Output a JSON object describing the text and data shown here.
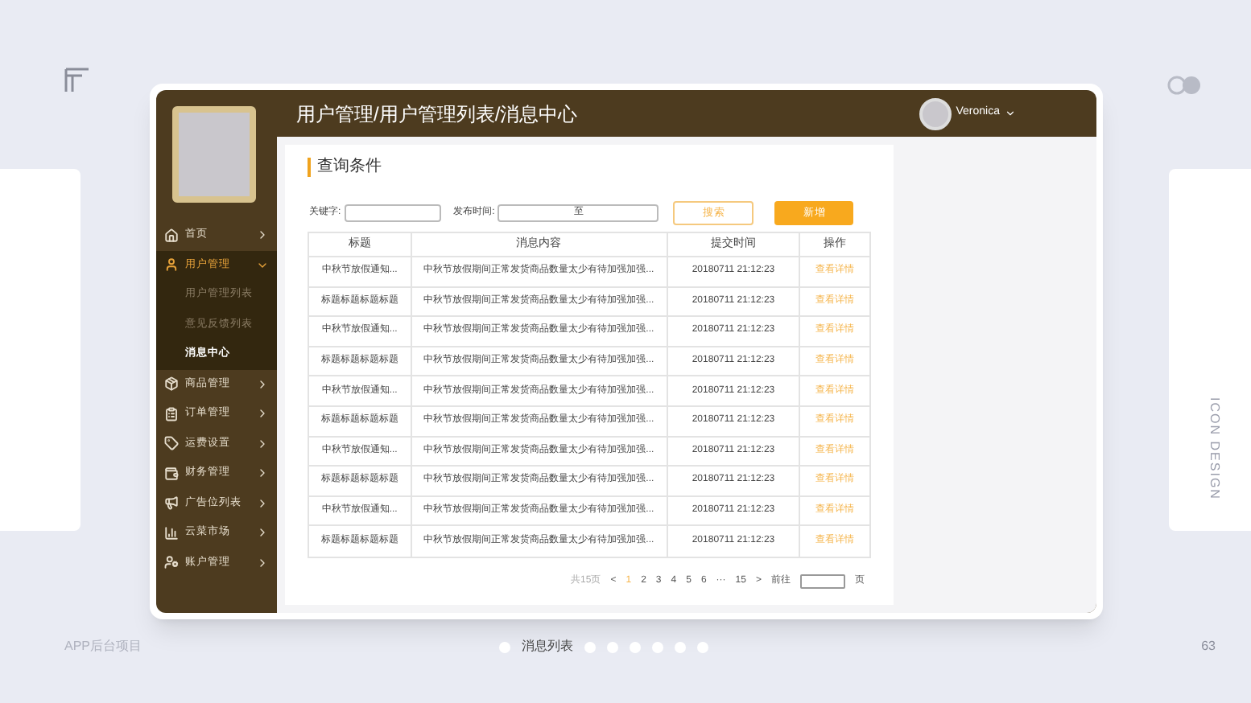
{
  "slide": {
    "caption": "APP后台项目",
    "page_number": "63",
    "side_label": "ICON DESIGN",
    "nav_dots": [
      {
        "kind": "dot",
        "selected": false
      },
      {
        "kind": "label",
        "label": "消息列表",
        "selected": true
      },
      {
        "kind": "dot",
        "selected": false
      },
      {
        "kind": "dot",
        "selected": false
      },
      {
        "kind": "dot",
        "selected": false
      },
      {
        "kind": "dot",
        "selected": false
      },
      {
        "kind": "dot",
        "selected": false
      },
      {
        "kind": "dot",
        "selected": false
      }
    ]
  },
  "header": {
    "breadcrumb": "用户管理/用户管理列表/消息中心",
    "user": "Veronica"
  },
  "sidebar": {
    "items": [
      {
        "label": "首页",
        "expanded": false,
        "selected": false
      },
      {
        "label": "用户管理",
        "expanded": true,
        "selected": true,
        "children": [
          {
            "label": "用户管理列表",
            "selected": false
          },
          {
            "label": "意见反馈列表",
            "selected": false
          },
          {
            "label": "消息中心",
            "selected": true
          }
        ]
      },
      {
        "label": "商品管理",
        "expanded": false,
        "selected": false
      },
      {
        "label": "订单管理",
        "expanded": false,
        "selected": false
      },
      {
        "label": "运费设置",
        "expanded": false,
        "selected": false
      },
      {
        "label": "财务管理",
        "expanded": false,
        "selected": false
      },
      {
        "label": "广告位列表",
        "expanded": false,
        "selected": false
      },
      {
        "label": "云菜市场",
        "expanded": false,
        "selected": false
      },
      {
        "label": "账户管理",
        "expanded": false,
        "selected": false
      }
    ]
  },
  "query": {
    "title": "查询条件",
    "keyword_label": "关键字:",
    "date_label": "发布时间:",
    "date_separator": "至",
    "search_button": "搜索",
    "add_button": "新增"
  },
  "table": {
    "columns": [
      "标题",
      "消息内容",
      "提交时间",
      "操作"
    ],
    "rows": [
      [
        "中秋节放假通知...",
        "中秋节放假期间正常发货商品数量太少有待加强加强...",
        "20180711 21:12:23",
        "查看详情"
      ],
      [
        "标题标题标题标题",
        "中秋节放假期间正常发货商品数量太少有待加强加强...",
        "20180711 21:12:23",
        "查看详情"
      ],
      [
        "中秋节放假通知...",
        "中秋节放假期间正常发货商品数量太少有待加强加强...",
        "20180711 21:12:23",
        "查看详情"
      ],
      [
        "标题标题标题标题",
        "中秋节放假期间正常发货商品数量太少有待加强加强...",
        "20180711 21:12:23",
        "查看详情"
      ],
      [
        "中秋节放假通知...",
        "中秋节放假期间正常发货商品数量太少有待加强加强...",
        "20180711 21:12:23",
        "查看详情"
      ],
      [
        "标题标题标题标题",
        "中秋节放假期间正常发货商品数量太少有待加强加强...",
        "20180711 21:12:23",
        "查看详情"
      ],
      [
        "中秋节放假通知...",
        "中秋节放假期间正常发货商品数量太少有待加强加强...",
        "20180711 21:12:23",
        "查看详情"
      ],
      [
        "标题标题标题标题",
        "中秋节放假期间正常发货商品数量太少有待加强加强...",
        "20180711 21:12:23",
        "查看详情"
      ],
      [
        "中秋节放假通知...",
        "中秋节放假期间正常发货商品数量太少有待加强加强...",
        "20180711 21:12:23",
        "查看详情"
      ],
      [
        "标题标题标题标题",
        "中秋节放假期间正常发货商品数量太少有待加强加强...",
        "20180711 21:12:23",
        "查看详情"
      ]
    ]
  },
  "pagination": {
    "total": "共15页",
    "prev": "<",
    "next": ">",
    "pages": [
      {
        "label": "1",
        "selected": true
      },
      {
        "label": "2",
        "selected": false
      },
      {
        "label": "3",
        "selected": false
      },
      {
        "label": "4",
        "selected": false
      },
      {
        "label": "5",
        "selected": false
      },
      {
        "label": "6",
        "selected": false
      },
      {
        "label": "···",
        "selected": false
      },
      {
        "label": "15",
        "selected": false
      }
    ],
    "goto_label": "前往",
    "page_suffix": "页"
  }
}
